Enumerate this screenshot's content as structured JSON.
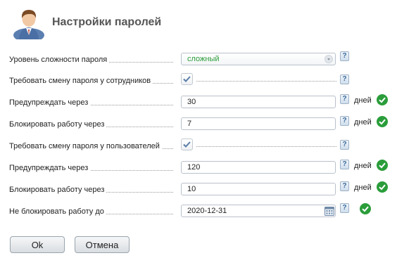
{
  "header": {
    "title": "Настройки паролей"
  },
  "help_label": "?",
  "form": {
    "complexity": {
      "label": "Уровень сложности пароля",
      "value": "сложный"
    },
    "staff_require_change": {
      "label": "Требовать смену пароля у сотрудников",
      "checked": true
    },
    "staff_warn": {
      "label": "Предупреждать через",
      "value": "30",
      "unit": "дней"
    },
    "staff_block": {
      "label": "Блокировать работу через",
      "value": "7",
      "unit": "дней"
    },
    "users_require_change": {
      "label": "Требовать смену пароля у пользователей",
      "checked": true
    },
    "users_warn": {
      "label": "Предупреждать через",
      "value": "120",
      "unit": "дней"
    },
    "users_block": {
      "label": "Блокировать работу через",
      "value": "10",
      "unit": "дней"
    },
    "no_block_until": {
      "label": "Не блокировать работу до",
      "value": "2020-12-31"
    }
  },
  "buttons": {
    "ok": "Ok",
    "cancel": "Отмена"
  },
  "colors": {
    "accent_green": "#2a9d3a",
    "help_blue": "#3c6a9a"
  },
  "icons": {
    "avatar": "user-avatar-icon",
    "help": "help-icon",
    "valid": "check-circle-icon",
    "calendar": "calendar-icon",
    "dropdown": "chevron-down-icon"
  }
}
